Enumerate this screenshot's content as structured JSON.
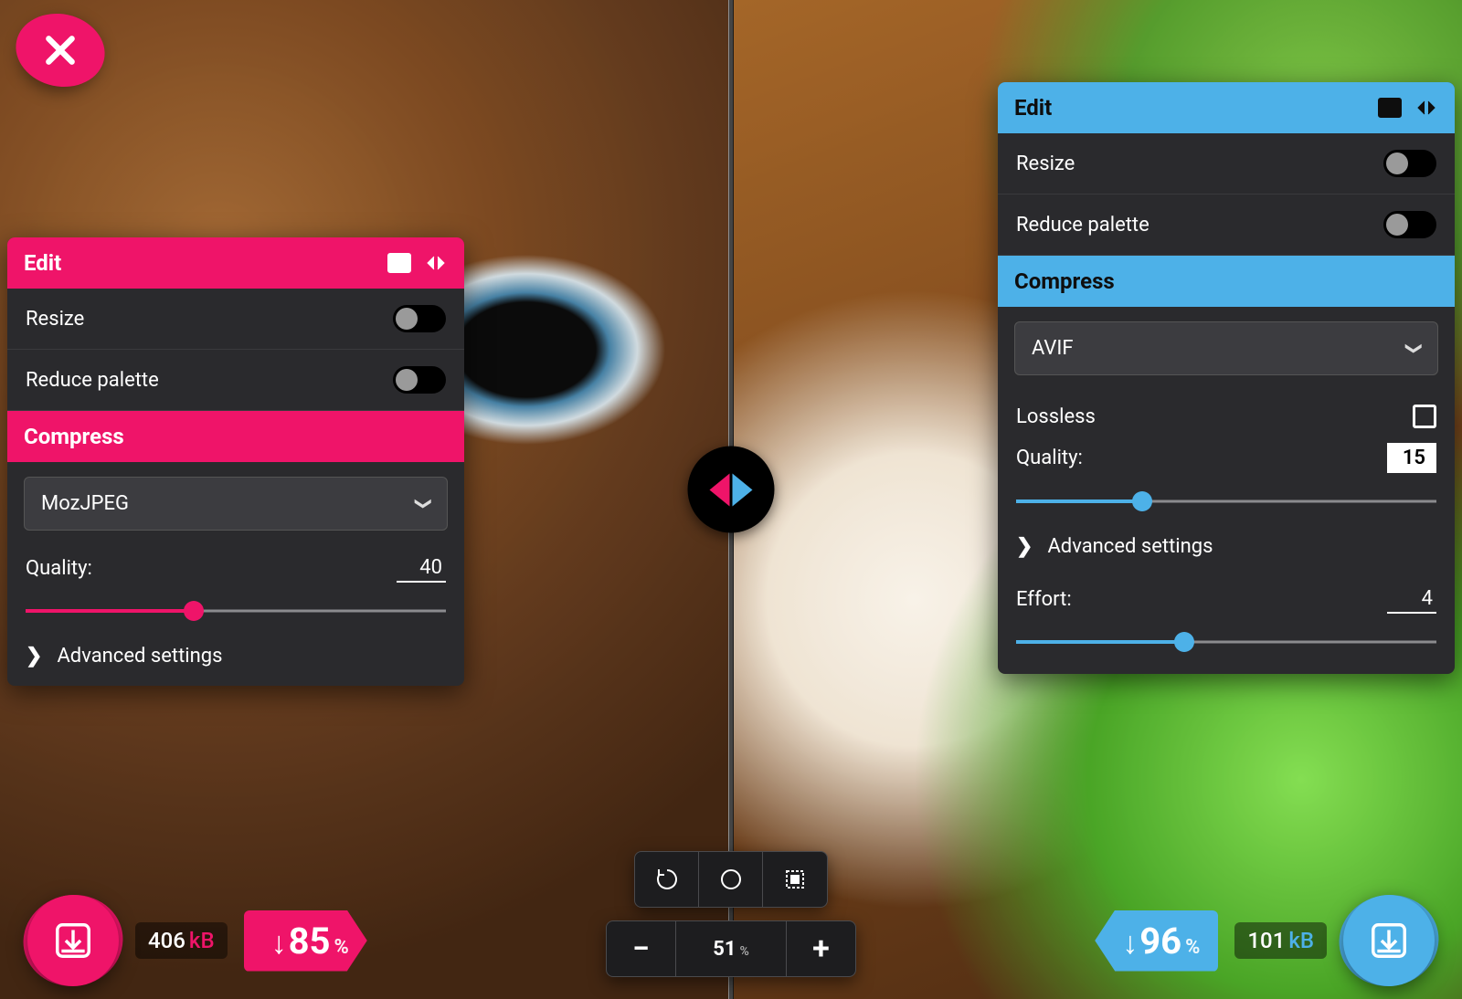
{
  "close_label": "Close",
  "left": {
    "edit_title": "Edit",
    "resize_label": "Resize",
    "reduce_palette_label": "Reduce palette",
    "compress_title": "Compress",
    "codec": "MozJPEG",
    "quality_label": "Quality:",
    "quality_value": "40",
    "quality_pct": 40,
    "advanced_label": "Advanced settings",
    "size_value": "406",
    "size_unit": "kB",
    "reduction_pct": "85",
    "reduction_unit": "%",
    "reduction_prefix": "↓"
  },
  "right": {
    "edit_title": "Edit",
    "resize_label": "Resize",
    "reduce_palette_label": "Reduce palette",
    "compress_title": "Compress",
    "codec": "AVIF",
    "lossless_label": "Lossless",
    "quality_label": "Quality:",
    "quality_value": "15",
    "quality_pct": 30,
    "advanced_label": "Advanced settings",
    "effort_label": "Effort:",
    "effort_value": "4",
    "effort_pct": 40,
    "size_value": "101",
    "size_unit": "kB",
    "reduction_pct": "96",
    "reduction_unit": "%",
    "reduction_prefix": "↓"
  },
  "zoom": {
    "value": "51",
    "unit": "%",
    "minus": "−",
    "plus": "+"
  }
}
